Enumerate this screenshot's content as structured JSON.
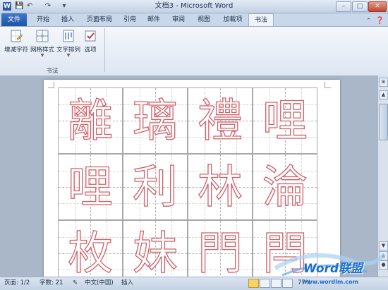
{
  "title_bar": {
    "app_title": "文档3 - Microsoft Word",
    "logo_letter": "W",
    "quick_access": [
      "save-icon",
      "undo-icon",
      "redo-icon",
      "customize-icon"
    ],
    "window_buttons": [
      "minimize",
      "maximize",
      "close"
    ]
  },
  "tabs": [
    "文件",
    "开始",
    "插入",
    "页面布局",
    "引用",
    "邮件",
    "审阅",
    "视图",
    "加载项",
    "书法"
  ],
  "active_tab": "书法",
  "ribbon": {
    "buttons": [
      {
        "label": "增减字符",
        "icon": "add-remove-characters-icon"
      },
      {
        "label": "网格样式",
        "icon": "grid-style-icon"
      },
      {
        "label": "文字排列",
        "icon": "text-arrangement-icon"
      },
      {
        "label": "选项",
        "icon": "options-icon"
      }
    ],
    "group_label": "书法"
  },
  "document": {
    "characters": [
      "離",
      "璃",
      "禮",
      "哩",
      "哩",
      "利",
      "林",
      "淪",
      "枚",
      "妹",
      "門",
      "閂"
    ],
    "outline_color": "#d0606a"
  },
  "status_bar": {
    "page": "页面: 1/2",
    "word_count": "字数: 21",
    "language": "中文(中国)",
    "mode": "插入",
    "zoom": "77%"
  },
  "watermark": {
    "text": "Word联盟",
    "url": "www.wordlm.com"
  },
  "colors": {
    "file_tab": "#1f54a6",
    "ribbon": "#dde6f2",
    "character_outline": "#d0606a"
  }
}
